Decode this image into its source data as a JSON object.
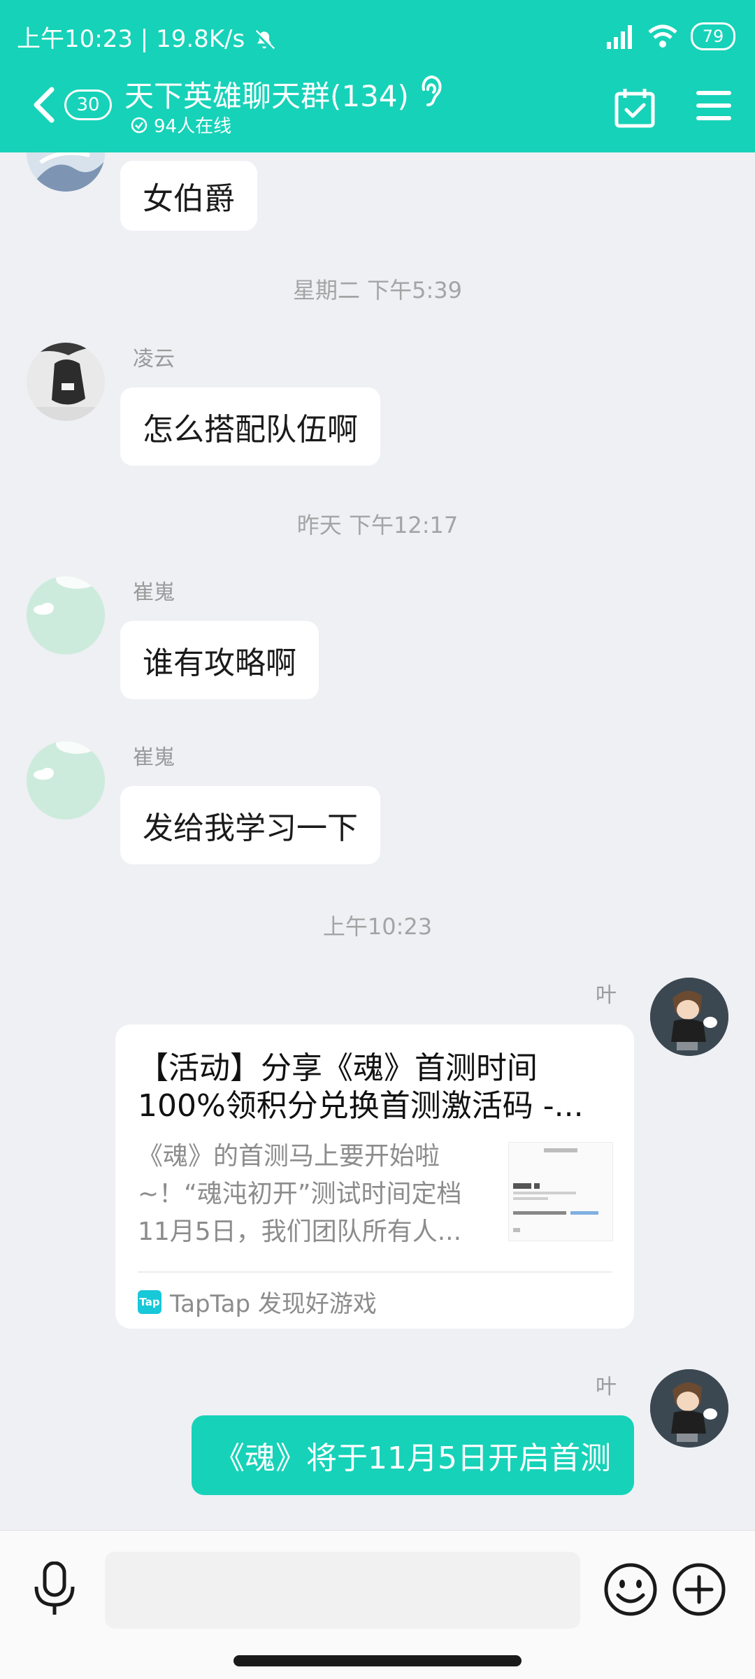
{
  "status_bar": {
    "time": "上午10:23",
    "net_speed": "19.8K/s",
    "battery": "79"
  },
  "header": {
    "unread_count": "30",
    "title": "天下英雄聊天群(134)",
    "online": "94人在线"
  },
  "messages": {
    "m1": {
      "text": "女伯爵"
    },
    "t1": "星期二 下午5:39",
    "m2": {
      "sender": "凌云",
      "text": "怎么搭配队伍啊"
    },
    "t2": "昨天 下午12:17",
    "m3": {
      "sender": "崔嵬",
      "text": "谁有攻略啊"
    },
    "m4": {
      "sender": "崔嵬",
      "text": "发给我学习一下"
    },
    "t3": "上午10:23",
    "m5": {
      "sender": "叶",
      "card_title": "【活动】分享《魂》首测时间100%领积分兑换首测激活码 -...",
      "card_desc": "《魂》的首测马上要开始啦~！“魂沌初开”测试时间定档11月5日，我们团队所有人...",
      "card_source": "TapTap 发现好游戏",
      "tap_logo": "Tap"
    },
    "m6": {
      "sender": "叶",
      "text": "《魂》将于11月5日开启首测"
    }
  },
  "input": {
    "placeholder": ""
  },
  "colors": {
    "accent": "#16d2b8",
    "chat_bg": "#eef0f4",
    "bubble": "#ffffff"
  }
}
